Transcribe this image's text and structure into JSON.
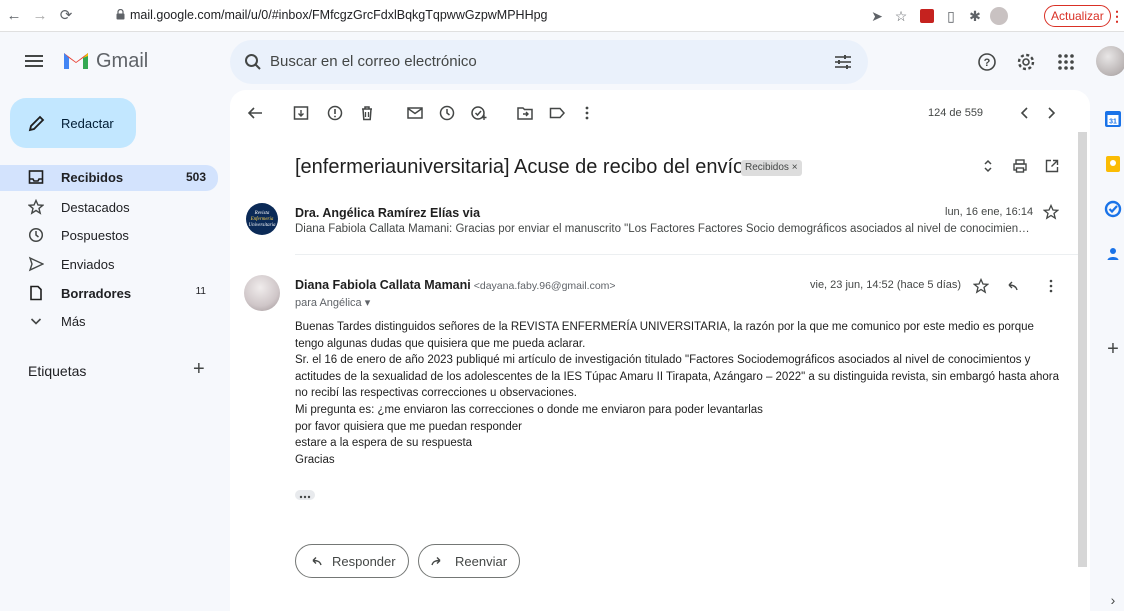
{
  "browser": {
    "url": "mail.google.com/mail/u/0/#inbox/FMfcgzGrcFdxlBqkgTqpwwGzpwMPHHpg",
    "update_label": "Actualizar"
  },
  "app": {
    "name": "Gmail",
    "search_placeholder": "Buscar en el correo electrónico"
  },
  "sidebar": {
    "compose_label": "Redactar",
    "items": [
      {
        "label": "Recibidos",
        "count": "503",
        "icon": "inbox-icon"
      },
      {
        "label": "Destacados",
        "count": "",
        "icon": "star-icon"
      },
      {
        "label": "Pospuestos",
        "count": "",
        "icon": "clock-icon"
      },
      {
        "label": "Enviados",
        "count": "",
        "icon": "send-icon"
      },
      {
        "label": "Borradores",
        "count": "11",
        "icon": "draft-icon"
      },
      {
        "label": "Más",
        "count": "",
        "icon": "chevron-down-icon"
      }
    ],
    "labels_title": "Etiquetas"
  },
  "toolbar": {
    "pager": "124 de 559"
  },
  "thread": {
    "subject": "[enfermeriauniversitaria] Acuse de recibo del envío",
    "label_chip": "Recibidos ×"
  },
  "message1": {
    "sender": "Dra. Angélica Ramírez Elías via",
    "date": "lun, 16 ene, 16:14",
    "snippet": "Diana Fabiola Callata Mamani: Gracias por enviar el manuscrito \"Los Factores Factores Socio demográficos asociados al nivel de conocimientos y ...",
    "avatar_text": [
      "Revista",
      "Enfermería",
      "Universitaria"
    ]
  },
  "message2": {
    "sender_name": "Diana Fabiola Callata Mamani",
    "sender_email": "<dayana.faby.96@gmail.com>",
    "to": "para Angélica ▾",
    "date": "vie, 23 jun, 14:52 (hace 5 días)",
    "body": [
      "Buenas Tardes distinguidos señores de la REVISTA ENFERMERÍA UNIVERSITARIA, la razón por la que me comunico por este medio es porque",
      "tengo algunas dudas que quisiera que me pueda aclarar.",
      "Sr. el 16 de enero de año 2023 publiqué mi artículo de investigación titulado \"Factores Sociodemográficos asociados al nivel de conocimientos y",
      "actitudes de la sexualidad de los adolescentes de la IES Túpac Amaru II Tirapata, Azángaro – 2022\" a su distinguida revista, sin embargó hasta ahora",
      "no recibí las respectivas correcciones u observaciones.",
      "Mi pregunta es: ¿me enviaron las correcciones o donde me enviaron para poder levantarlas",
      "por favor quisiera que me puedan responder",
      "estare a la espera de su respuesta",
      "Gracias"
    ],
    "reply_label": "Responder",
    "forward_label": "Reenviar"
  },
  "colors": {
    "compose_bg": "#c2e7ff",
    "selected_nav_bg": "#d3e3fd",
    "search_bg": "#eaf1fb",
    "app_bg": "#f6f8fc",
    "update_red": "#d93025"
  }
}
